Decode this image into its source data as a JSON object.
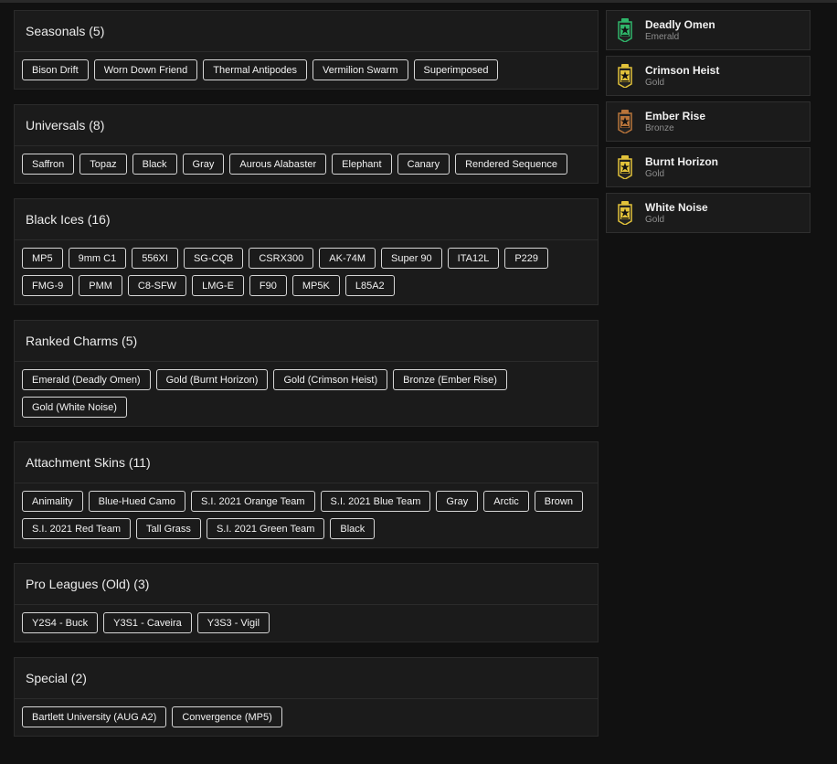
{
  "sections": [
    {
      "title": "Seasonals (5)",
      "items": [
        "Bison Drift",
        "Worn Down Friend",
        "Thermal Antipodes",
        "Vermilion Swarm",
        "Superimposed"
      ]
    },
    {
      "title": "Universals (8)",
      "items": [
        "Saffron",
        "Topaz",
        "Black",
        "Gray",
        "Aurous Alabaster",
        "Elephant",
        "Canary",
        "Rendered Sequence"
      ]
    },
    {
      "title": "Black Ices (16)",
      "items": [
        "MP5",
        "9mm C1",
        "556XI",
        "SG-CQB",
        "CSRX300",
        "AK-74M",
        "Super 90",
        "ITA12L",
        "P229",
        "FMG-9",
        "PMM",
        "C8-SFW",
        "LMG-E",
        "F90",
        "MP5K",
        "L85A2"
      ]
    },
    {
      "title": "Ranked Charms (5)",
      "items": [
        "Emerald (Deadly Omen)",
        "Gold (Burnt Horizon)",
        "Gold (Crimson Heist)",
        "Bronze (Ember Rise)",
        "Gold (White Noise)"
      ]
    },
    {
      "title": "Attachment Skins (11)",
      "items": [
        "Animality",
        "Blue-Hued Camo",
        "S.I. 2021 Orange Team",
        "S.I. 2021 Blue Team",
        "Gray",
        "Arctic",
        "Brown",
        "S.I. 2021 Red Team",
        "Tall Grass",
        "S.I. 2021 Green Team",
        "Black"
      ]
    },
    {
      "title": "Pro Leagues (Old) (3)",
      "items": [
        "Y2S4 - Buck",
        "Y3S1 - Caveira",
        "Y3S3 - Vigil"
      ]
    },
    {
      "title": "Special (2)",
      "items": [
        "Bartlett University (AUG A2)",
        "Convergence (MP5)"
      ]
    }
  ],
  "charms": [
    {
      "name": "Deadly Omen",
      "tier": "Emerald",
      "icon": "emerald-rank-charm-icon",
      "color": "#2fb56a"
    },
    {
      "name": "Crimson Heist",
      "tier": "Gold",
      "icon": "gold-rank-charm-icon",
      "color": "#e2c23a"
    },
    {
      "name": "Ember Rise",
      "tier": "Bronze",
      "icon": "bronze-rank-charm-icon",
      "color": "#b8743a"
    },
    {
      "name": "Burnt Horizon",
      "tier": "Gold",
      "icon": "gold-rank-charm-icon",
      "color": "#e2c23a"
    },
    {
      "name": "White Noise",
      "tier": "Gold",
      "icon": "gold-rank-charm-icon",
      "color": "#e2c23a"
    }
  ]
}
